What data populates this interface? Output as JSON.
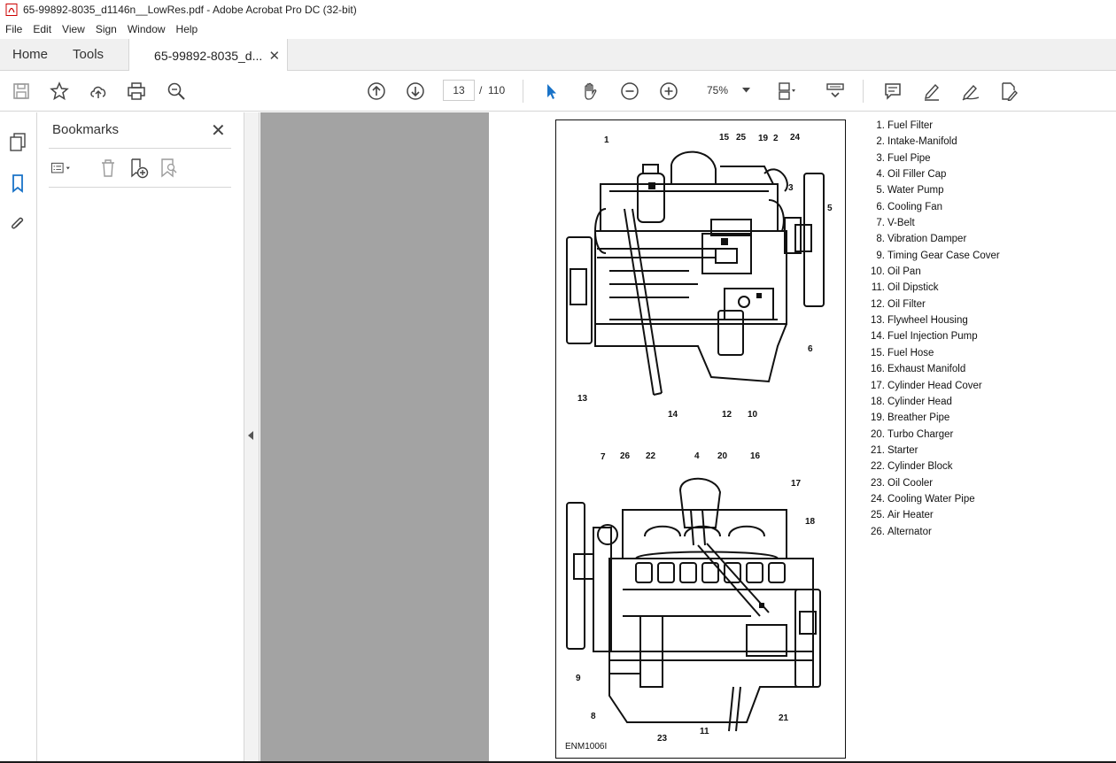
{
  "window": {
    "title": "65-99892-8035_d1146n__LowRes.pdf - Adobe Acrobat Pro DC (32-bit)"
  },
  "menu": [
    "File",
    "Edit",
    "View",
    "Sign",
    "Window",
    "Help"
  ],
  "tabs": {
    "home": "Home",
    "tools": "Tools",
    "document": "65-99892-8035_d...",
    "close": "✕"
  },
  "toolbar": {
    "current_page": "13",
    "page_separator": "/",
    "total_pages": "110",
    "zoom": "75%"
  },
  "bookmarks": {
    "title": "Bookmarks",
    "close": "✕"
  },
  "document": {
    "figure_id": "ENM1006I",
    "legend": [
      {
        "num": "1.",
        "label": "Fuel Filter"
      },
      {
        "num": "2.",
        "label": "Intake-Manifold"
      },
      {
        "num": "3.",
        "label": "Fuel Pipe"
      },
      {
        "num": "4.",
        "label": "Oil Filler Cap"
      },
      {
        "num": "5.",
        "label": "Water Pump"
      },
      {
        "num": "6.",
        "label": "Cooling Fan"
      },
      {
        "num": "7.",
        "label": "V-Belt"
      },
      {
        "num": "8.",
        "label": "Vibration Damper"
      },
      {
        "num": "9.",
        "label": "Timing Gear Case Cover"
      },
      {
        "num": "10.",
        "label": "Oil Pan"
      },
      {
        "num": "11.",
        "label": "Oil Dipstick"
      },
      {
        "num": "12.",
        "label": "Oil Filter"
      },
      {
        "num": "13.",
        "label": "Flywheel Housing"
      },
      {
        "num": "14.",
        "label": "Fuel Injection Pump"
      },
      {
        "num": "15.",
        "label": "Fuel Hose"
      },
      {
        "num": "16.",
        "label": "Exhaust Manifold"
      },
      {
        "num": "17.",
        "label": "Cylinder Head Cover"
      },
      {
        "num": "18.",
        "label": "Cylinder Head"
      },
      {
        "num": "19.",
        "label": "Breather Pipe"
      },
      {
        "num": "20.",
        "label": "Turbo Charger"
      },
      {
        "num": "21.",
        "label": "Starter"
      },
      {
        "num": "22.",
        "label": "Cylinder Block"
      },
      {
        "num": "23.",
        "label": "Oil Cooler"
      },
      {
        "num": "24.",
        "label": "Cooling Water Pipe"
      },
      {
        "num": "25.",
        "label": "Air Heater"
      },
      {
        "num": "26.",
        "label": "Alternator"
      }
    ],
    "callouts_top": [
      "1",
      "15",
      "25",
      "19",
      "2",
      "24",
      "3",
      "5",
      "6",
      "13",
      "14",
      "12",
      "10"
    ],
    "callouts_bottom": [
      "7",
      "26",
      "22",
      "4",
      "20",
      "16",
      "17",
      "18",
      "9",
      "8",
      "23",
      "11",
      "21"
    ]
  }
}
